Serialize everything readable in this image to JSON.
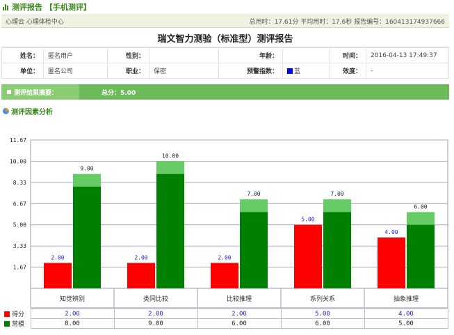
{
  "header": {
    "title": "测评报告 【手机测评】",
    "org": "心理云 心理体检中心",
    "stats": "总用时：17.61分 平均用时：17.6秒 报告编号：160413174937666"
  },
  "report_title": "瑞文智力测验（标准型）测评报告",
  "info": {
    "name_label": "姓名：",
    "name": "匿名用户",
    "gender_label": "性别：",
    "gender": "",
    "age_label": "年龄：",
    "age": "",
    "time_label": "时间：",
    "time": "2016-04-13 17:49:37",
    "unit_label": "单位：",
    "unit": "匿名公司",
    "job_label": "职业：",
    "job": "保密",
    "warn_label": "预警指数：",
    "warn": "蓝",
    "validity_label": "效度：",
    "validity": "-"
  },
  "summary": {
    "label": "测评结果摘要：",
    "value": "总分：5.00"
  },
  "section_title": "测评因素分析",
  "colors": {
    "score": "#ff0000",
    "norm": "#008000",
    "norm_light": "#66cc66",
    "warn_blue": "#0000ee"
  },
  "chart_data": {
    "type": "bar",
    "categories": [
      "知觉辨别",
      "类同比较",
      "比较推理",
      "系列关系",
      "抽象推理"
    ],
    "series": [
      {
        "name": "得分",
        "values": [
          2.0,
          2.0,
          2.0,
          5.0,
          4.0
        ],
        "color": "#ff0000"
      },
      {
        "name": "常模",
        "values": [
          8.0,
          9.0,
          6.0,
          6.0,
          5.0
        ],
        "color": "#008000"
      }
    ],
    "norm_labels": [
      9.0,
      10.0,
      7.0,
      7.0,
      6.0
    ],
    "ylim": [
      0,
      11.67
    ],
    "yticks": [
      "1.67",
      "3.33",
      "5.00",
      "6.67",
      "8.33",
      "10.00",
      "11.67"
    ],
    "grid": true,
    "value_labels": {
      "score": [
        "2.00",
        "2.00",
        "2.00",
        "5.00",
        "4.00"
      ],
      "norm": [
        "9.00",
        "10.00",
        "7.00",
        "7.00",
        "6.00"
      ]
    }
  },
  "table": {
    "rows": [
      {
        "name": "得分",
        "values": [
          "2.00",
          "2.00",
          "2.00",
          "5.00",
          "4.00"
        ]
      },
      {
        "name": "常模",
        "values": [
          "8.00",
          "9.00",
          "6.00",
          "6.00",
          "5.00"
        ]
      }
    ]
  }
}
